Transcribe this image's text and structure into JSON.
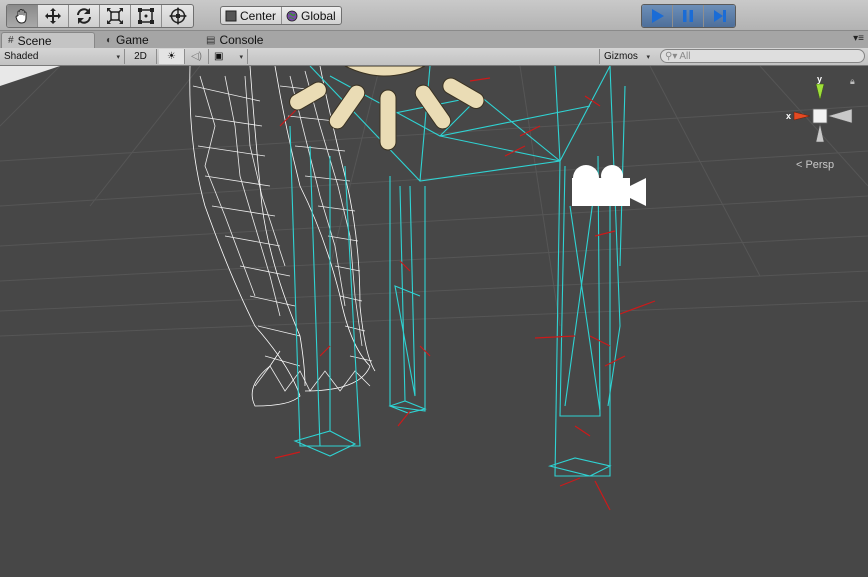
{
  "toolbar": {
    "tools": [
      "hand-tool",
      "move-tool",
      "rotate-tool",
      "scale-tool",
      "rect-tool",
      "transform-tool"
    ],
    "pivot_label": "Center",
    "space_label": "Global",
    "play": [
      "play",
      "pause",
      "step"
    ]
  },
  "tabs": [
    {
      "label": "Scene",
      "icon": "scene-icon",
      "active": true
    },
    {
      "label": "Game",
      "icon": "game-icon",
      "active": false
    },
    {
      "label": "Console",
      "icon": "console-icon",
      "active": false
    }
  ],
  "scene_toolbar": {
    "draw_mode": "Shaded",
    "mode_2d": "2D",
    "gizmos_label": "Gizmos",
    "search_placeholder": "All"
  },
  "gizmo": {
    "y_label": "y",
    "x_label": "x",
    "projection_label": "Persp"
  },
  "colors": {
    "toolbar_bg": "#b9b9b9",
    "viewport_bg": "#474747",
    "wire_cyan": "#2fd3d3",
    "wire_white": "#ffffff",
    "wire_red": "#d01c1c",
    "play_active": "#5577a6"
  }
}
